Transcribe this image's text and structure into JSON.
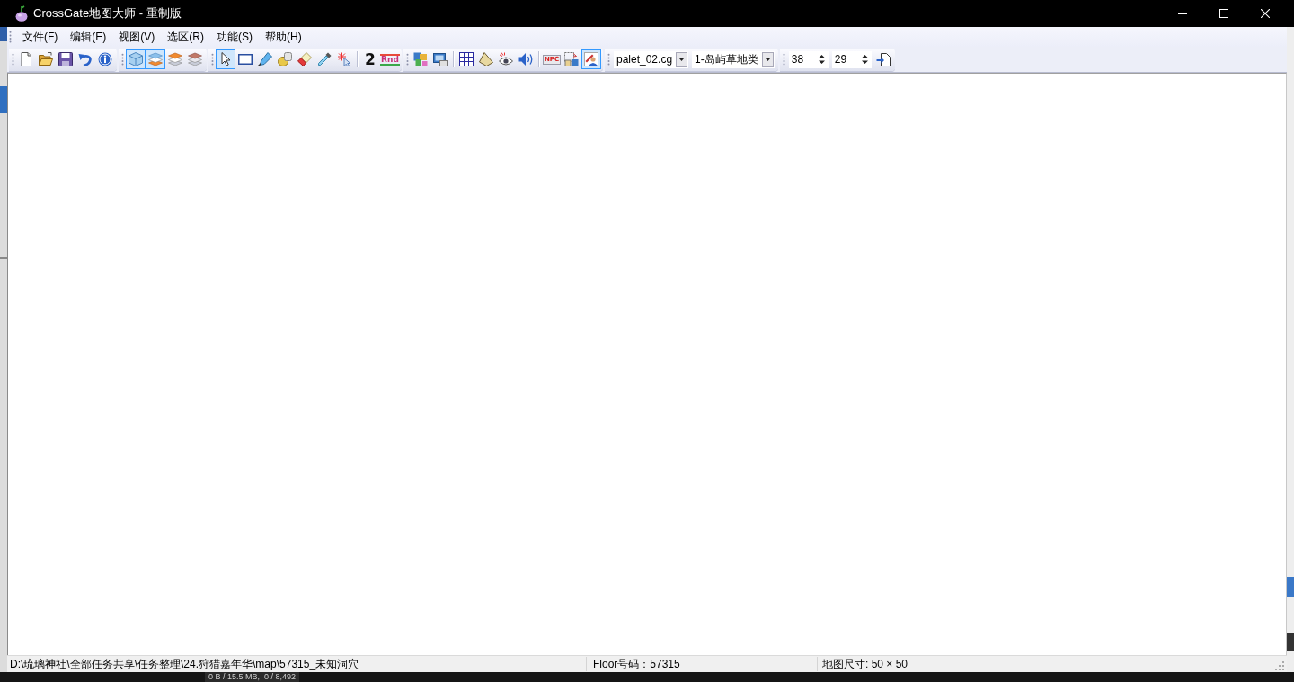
{
  "window": {
    "title": "CrossGate地图大师 - 重制版"
  },
  "menu": [
    {
      "label": "文件(F)"
    },
    {
      "label": "编辑(E)"
    },
    {
      "label": "视图(V)"
    },
    {
      "label": "选区(R)"
    },
    {
      "label": "功能(S)"
    },
    {
      "label": "帮助(H)"
    }
  ],
  "toolbar": [
    {
      "sections": [
        [
          {
            "kind": "button"
          },
          {
            "kind": "button"
          },
          {
            "kind": "button"
          },
          {
            "kind": "button"
          },
          {
            "kind": "button"
          }
        ]
      ]
    },
    {
      "sections": [
        [
          {
            "kind": "button",
            "selected": true
          },
          {
            "kind": "button",
            "selected": true
          },
          {
            "kind": "button",
            "selected": false
          },
          {
            "kind": "button",
            "selected": false
          }
        ]
      ]
    },
    {
      "sections": [
        [
          {
            "kind": "button",
            "selected": true
          },
          {
            "kind": "button",
            "selected": false
          },
          {
            "kind": "button",
            "selected": false
          },
          {
            "kind": "button",
            "selected": false
          },
          {
            "kind": "button",
            "selected": false
          },
          {
            "kind": "button",
            "selected": false
          },
          {
            "kind": "button",
            "selected": false
          }
        ],
        [
          {
            "kind": "text",
            "label": "2"
          },
          {
            "kind": "text",
            "label": "Rnd"
          }
        ]
      ]
    },
    {
      "sections": [
        [
          {
            "kind": "button"
          },
          {
            "kind": "button"
          }
        ],
        [
          {
            "kind": "button",
            "selected": false
          },
          {
            "kind": "button",
            "selected": false
          },
          {
            "kind": "button",
            "selected": false
          },
          {
            "kind": "button",
            "selected": false
          }
        ],
        [
          {
            "kind": "text",
            "label": "NPC",
            "selected": false
          },
          {
            "kind": "button",
            "selected": false
          },
          {
            "kind": "button",
            "selected": true
          }
        ]
      ]
    },
    {
      "sections": [
        [
          {
            "kind": "combo",
            "value": "palet_02.cg"
          },
          {
            "kind": "combo",
            "value": "1-岛屿草地类"
          }
        ]
      ]
    },
    {
      "sections": [
        [
          {
            "kind": "spin",
            "value": "38"
          },
          {
            "kind": "spin",
            "value": "29"
          },
          {
            "kind": "button"
          }
        ]
      ]
    }
  ],
  "status_bar": {
    "path": "D:\\琉璃神社\\全部任务共享\\任务整理\\24.狩猎嘉年华\\map\\57315_未知洞穴",
    "floor": "Floor号码：57315",
    "map_size": "地图尺寸: 50 × 50"
  },
  "background_window": {
    "status_text": "0 B / 15.5 MB,  0 / 8,492"
  }
}
